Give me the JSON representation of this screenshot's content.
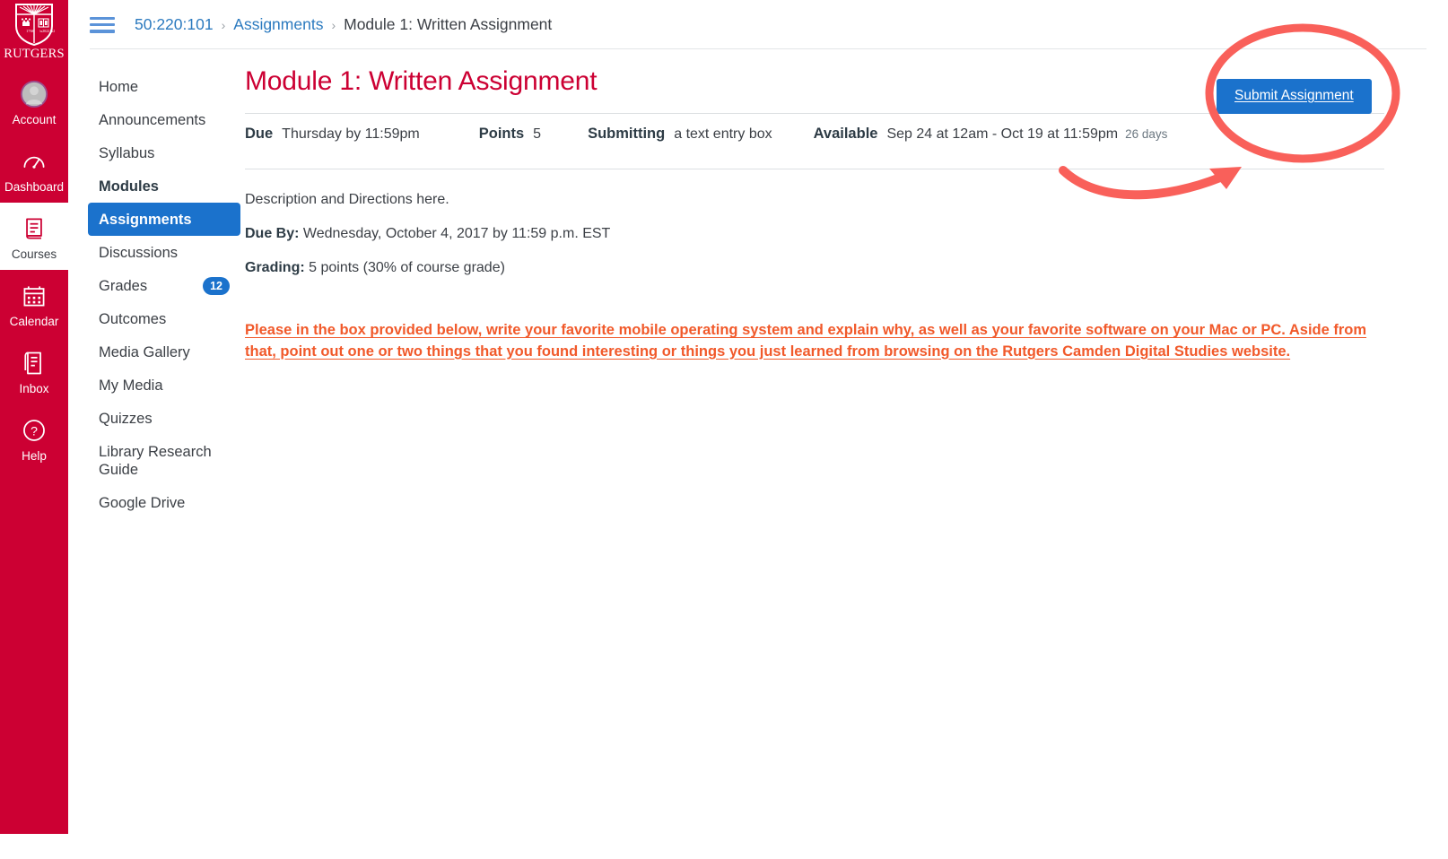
{
  "global_nav": {
    "logo_text": "RUTGERS",
    "logo_icon": "rutgers-shield-icon",
    "items": [
      {
        "label": "Account",
        "icon": "user-avatar-icon",
        "active": false
      },
      {
        "label": "Dashboard",
        "icon": "dashboard-icon",
        "active": false
      },
      {
        "label": "Courses",
        "icon": "book-icon",
        "active": true
      },
      {
        "label": "Calendar",
        "icon": "calendar-icon",
        "active": false
      },
      {
        "label": "Inbox",
        "icon": "inbox-icon",
        "active": false
      },
      {
        "label": "Help",
        "icon": "question-mark-icon",
        "active": false
      }
    ]
  },
  "breadcrumb": {
    "menu_icon": "hamburger-menu-icon",
    "separator": "›",
    "items": [
      {
        "label": "50:220:101",
        "current": false
      },
      {
        "label": "Assignments",
        "current": false
      },
      {
        "label": "Module 1: Written Assignment",
        "current": true
      }
    ]
  },
  "course_nav": {
    "items": [
      {
        "label": "Home",
        "state": "normal"
      },
      {
        "label": "Announcements",
        "state": "normal"
      },
      {
        "label": "Syllabus",
        "state": "normal"
      },
      {
        "label": "Modules",
        "state": "bold"
      },
      {
        "label": "Assignments",
        "state": "active"
      },
      {
        "label": "Discussions",
        "state": "normal"
      },
      {
        "label": "Grades",
        "state": "normal",
        "badge": "12"
      },
      {
        "label": "Outcomes",
        "state": "normal"
      },
      {
        "label": "Media Gallery",
        "state": "normal"
      },
      {
        "label": "My Media",
        "state": "normal"
      },
      {
        "label": "Quizzes",
        "state": "normal"
      },
      {
        "label": "Library Research Guide",
        "state": "normal"
      },
      {
        "label": "Google Drive",
        "state": "normal"
      }
    ]
  },
  "assignment": {
    "title": "Module 1: Written Assignment",
    "submit_label": "Submit Assignment",
    "meta": {
      "due_label": "Due",
      "due_value": "Thursday by 11:59pm",
      "points_label": "Points",
      "points_value": "5",
      "submitting_label": "Submitting",
      "submitting_value": "a text entry box",
      "available_label": "Available",
      "available_value": "Sep 24 at 12am - Oct 19 at 11:59pm",
      "available_note": "26 days"
    },
    "description": "Description and Directions here.",
    "due_by_label": "Due By:",
    "due_by_value": "Wednesday, October 4, 2017 by 11:59 p.m. EST",
    "grading_label": "Grading:",
    "grading_value": "5 points (30% of course grade)",
    "instructions": "Please in the box provided below, write your favorite mobile operating system and explain why, as well as your favorite software on your Mac or PC. Aside from that, point out one or two things that you found interesting or things you just learned from browsing on the Rutgers Camden Digital Studies website. "
  },
  "annotations": {
    "circle_target": "submit-assignment-button",
    "arrow_direction": "up-right"
  },
  "colors": {
    "rutgers_red": "#cc0033",
    "canvas_blue": "#1b72cc",
    "link_blue": "#2b7abf",
    "annotation_coral": "#f9605a",
    "instruction_orange": "#f1592a",
    "text_dark": "#3b3f45"
  }
}
